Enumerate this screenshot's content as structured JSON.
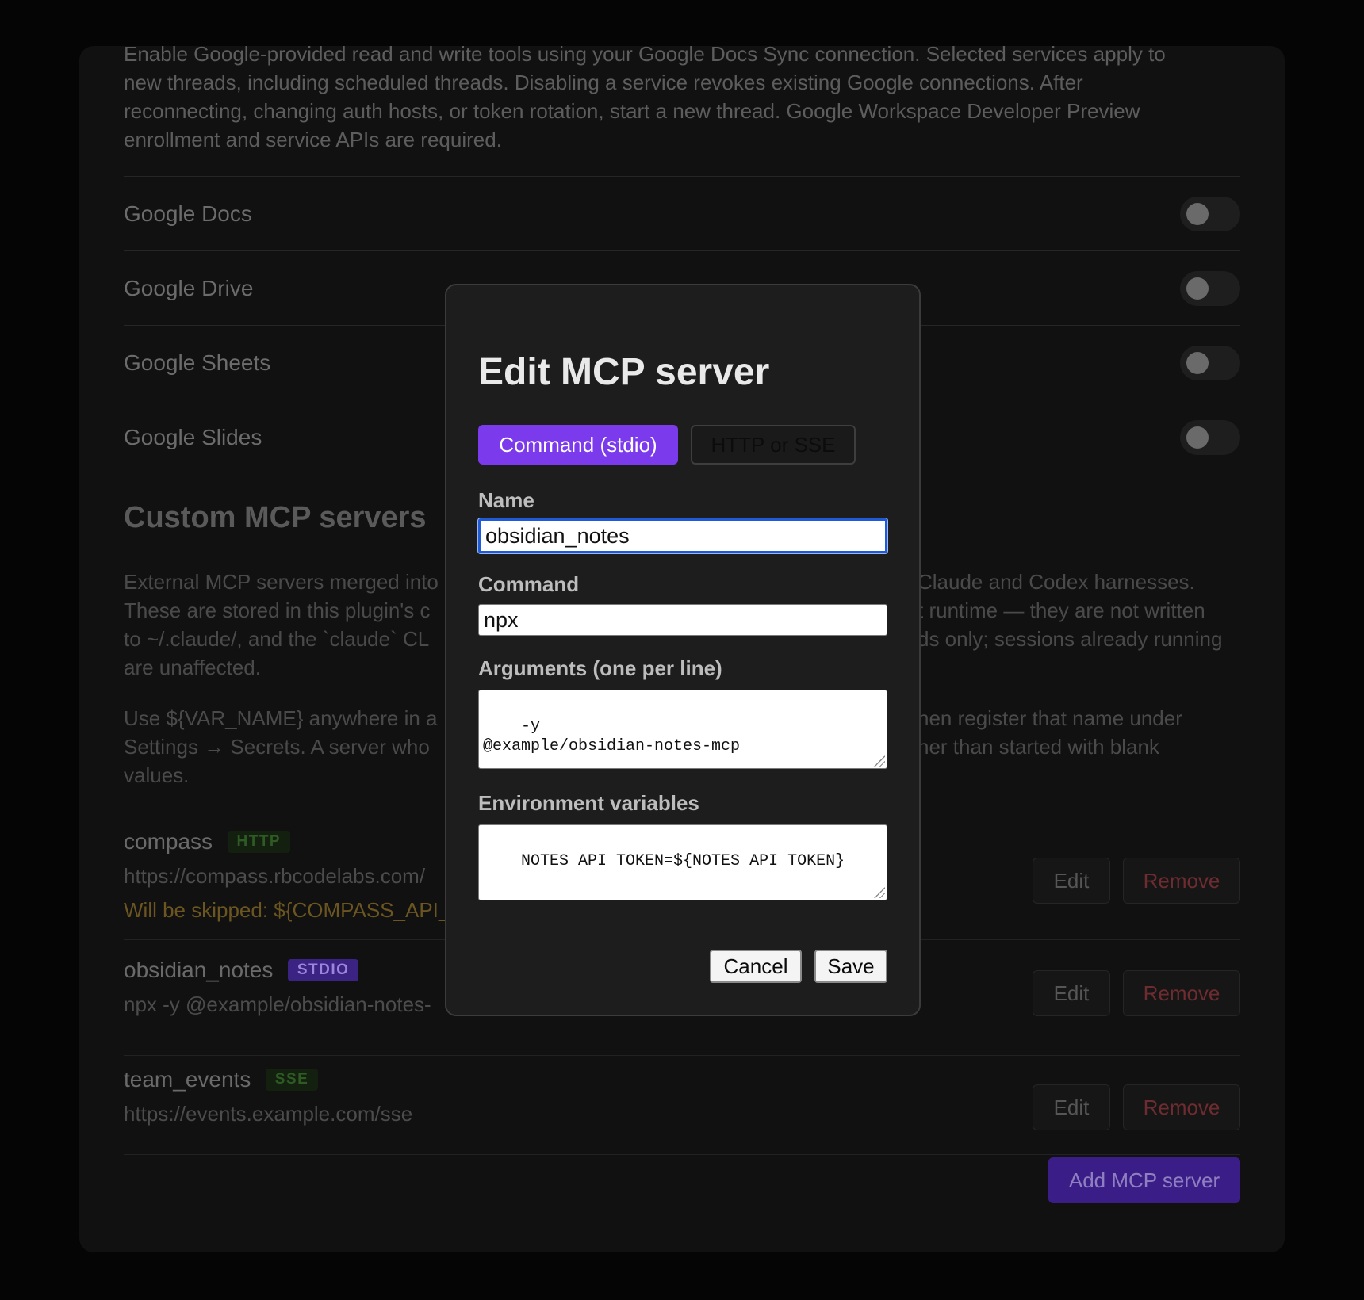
{
  "settings": {
    "intro_lines": [
      "Enable Google-provided read and write tools using your Google Docs Sync connection. Selected services apply to",
      "new threads, including scheduled threads. Disabling a service revokes existing Google connections. After",
      "reconnecting, changing auth hosts, or token rotation, start a new thread. Google Workspace Developer Preview",
      "enrollment and service APIs are required."
    ],
    "google_services": [
      {
        "label": "Google Docs",
        "enabled": false
      },
      {
        "label": "Google Drive",
        "enabled": false
      },
      {
        "label": "Google Sheets",
        "enabled": false
      },
      {
        "label": "Google Slides",
        "enabled": false
      }
    ],
    "custom_title": "Custom MCP servers",
    "custom_desc_lines": [
      "External MCP servers merged into",
      "These are stored in this plugin's c",
      "to ~/.claude/, and the `claude` CL",
      "are unaffected."
    ],
    "custom_desc_lines_right": [
      "Claude and Codex harnesses.",
      "t runtime — they are not written",
      "ds only; sessions already running",
      ""
    ],
    "secrets_desc_lines": [
      "Use ${VAR_NAME} anywhere in a",
      "Settings → Secrets. A server who",
      "values."
    ],
    "secrets_desc_lines_right": [
      "hen register that name under",
      "her than started with blank",
      ""
    ],
    "servers": [
      {
        "name": "compass",
        "badge": "HTTP",
        "detail": "https://compass.rbcodelabs.com/",
        "warning": "Will be skipped: ${COMPASS_API_K"
      },
      {
        "name": "obsidian_notes",
        "badge": "STDIO",
        "detail": "npx -y @example/obsidian-notes-"
      },
      {
        "name": "team_events",
        "badge": "SSE",
        "detail": "https://events.example.com/sse"
      }
    ],
    "edit_label": "Edit",
    "remove_label": "Remove",
    "add_label": "Add MCP server"
  },
  "modal": {
    "title": "Edit MCP server",
    "tab_stdio": "Command (stdio)",
    "tab_http": "HTTP or SSE",
    "name_label": "Name",
    "name_value": "obsidian_notes",
    "command_label": "Command",
    "command_value": "npx",
    "args_label": "Arguments (one per line)",
    "args_value": "-y\n@example/obsidian-notes-mcp",
    "env_label": "Environment variables",
    "env_value": "NOTES_API_TOKEN=${NOTES_API_TOKEN}",
    "cancel_label": "Cancel",
    "save_label": "Save"
  },
  "colors": {
    "accent": "#7c3aed",
    "remove": "#6e2c30",
    "focus": "#1f5bd6"
  }
}
